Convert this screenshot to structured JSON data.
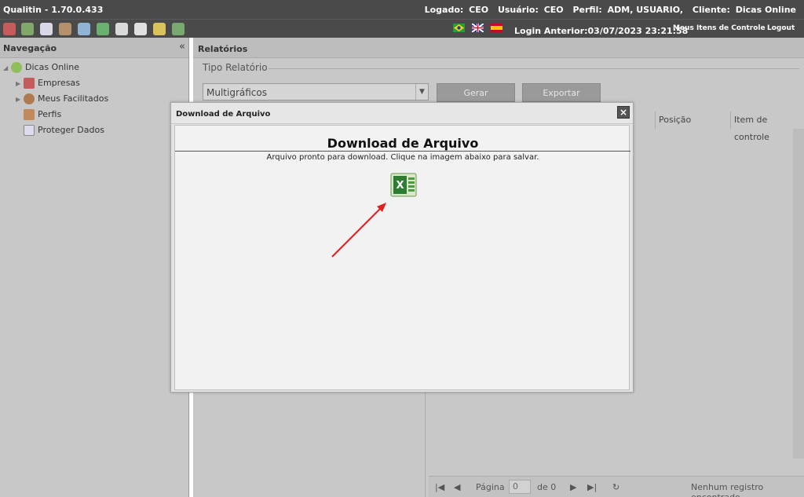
{
  "header": {
    "app_title": "Qualitin - 1.70.0.433",
    "logado_label": "Logado:",
    "logado_value": "CEO",
    "usuario_label": "Usuário:",
    "usuario_value": "CEO",
    "perfil_label": "Perfil:",
    "perfil_value": "ADM, USUARIO,",
    "cliente_label": "Cliente:",
    "cliente_value": "Dicas Online"
  },
  "toolbar": {
    "login_anterior": "Login Anterior:03/07/2023 23:21:58",
    "meus_itens": "Meus Itens de Controle",
    "logout": "Logout",
    "icons": [
      "rocket-icon",
      "users-icon",
      "calendar-icon",
      "tools-icon",
      "grid-icon",
      "report-icon",
      "print-icon",
      "book-icon",
      "shield-icon",
      "export-icon"
    ],
    "flags": [
      "flag-brazil-icon",
      "flag-uk-icon",
      "flag-spain-icon"
    ]
  },
  "nav": {
    "title": "Navegação",
    "collapse": "«",
    "items": [
      {
        "label": "Dicas Online"
      },
      {
        "label": "Empresas"
      },
      {
        "label": "Meus Facilitados"
      },
      {
        "label": "Perfis"
      },
      {
        "label": "Proteger Dados"
      }
    ]
  },
  "main": {
    "title": "Relatórios",
    "tipo_relatorio": "Tipo Relatório",
    "select_value": "Multigráficos",
    "gerar": "Gerar",
    "exportar": "Exportar",
    "columns": [
      "Posição",
      "Item de controle"
    ],
    "pager": {
      "pagina": "Página",
      "page_value": "0",
      "de": "de 0",
      "status": "Nenhum registro encontrado"
    }
  },
  "modal": {
    "title": "Download de Arquivo",
    "close": "×",
    "heading": "Download de Arquivo",
    "message": "Arquivo pronto para download. Clique na imagem abaixo para salvar."
  },
  "colors": {
    "topbar": "#4a4a4a",
    "panel": "#c8c8c8",
    "excel_green": "#2e7d32",
    "arrow_red": "#e32020"
  }
}
